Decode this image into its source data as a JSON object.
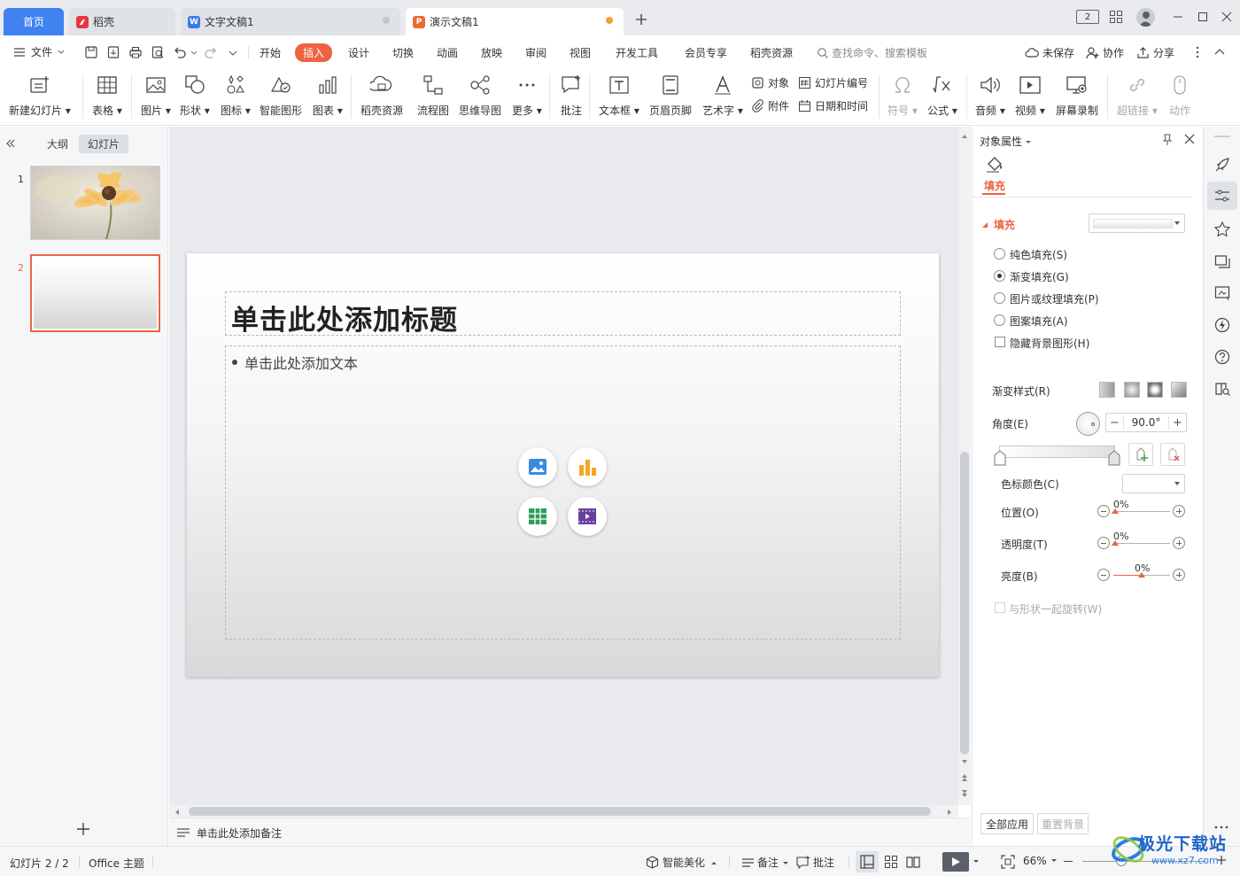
{
  "tabs": {
    "home": "首页",
    "daoke": "稻壳",
    "doc": "文字文稿1",
    "ppt": "演示文稿1",
    "version_badge": "2"
  },
  "menu": {
    "file": "文件",
    "items": [
      "开始",
      "插入",
      "设计",
      "切换",
      "动画",
      "放映",
      "审阅",
      "视图",
      "开发工具",
      "会员专享",
      "稻壳资源"
    ],
    "active": "插入",
    "search_placeholder": "查找命令、搜索模板",
    "unsaved": "未保存",
    "collab": "协作",
    "share": "分享"
  },
  "ribbon": {
    "new_slide": "新建幻灯片",
    "table": "表格",
    "picture": "图片",
    "shape": "形状",
    "icon": "图标",
    "smart_graphic": "智能图形",
    "chart": "图表",
    "daoke_resource": "稻壳资源",
    "flowchart": "流程图",
    "mindmap": "思维导图",
    "more": "更多",
    "comment": "批注",
    "textbox": "文本框",
    "header_footer": "页眉页脚",
    "wordart": "艺术字",
    "object": "对象",
    "attachment": "附件",
    "slide_number": "幻灯片编号",
    "datetime": "日期和时间",
    "symbol": "符号",
    "formula": "公式",
    "audio": "音频",
    "video": "视频",
    "screen_record": "屏幕录制",
    "hyperlink": "超链接",
    "action": "动作"
  },
  "left_panel": {
    "outline_tab": "大纲",
    "slides_tab": "幻灯片",
    "slide_numbers": [
      "1",
      "2"
    ]
  },
  "slide": {
    "title_placeholder": "单击此处添加标题",
    "body_placeholder": "单击此处添加文本"
  },
  "notes_placeholder": "单击此处添加备注",
  "props": {
    "title": "对象属性",
    "fill_tab": "填充",
    "fill_section": "填充",
    "solid_fill": "纯色填充(S)",
    "gradient_fill": "渐变填充(G)",
    "picture_fill": "图片或纹理填充(P)",
    "pattern_fill": "图案填充(A)",
    "hide_bg": "隐藏背景图形(H)",
    "gradient_style": "渐变样式(R)",
    "angle_label": "角度(E)",
    "angle_value": "90.0°",
    "stop_color": "色标颜色(C)",
    "position": "位置(O)",
    "position_value": "0%",
    "transparency": "透明度(T)",
    "transparency_value": "0%",
    "brightness": "亮度(B)",
    "brightness_value": "0%",
    "rotate_with_shape": "与形状一起旋转(W)",
    "apply_all": "全部应用",
    "reset_bg": "重置背景",
    "selected_fill": "gradient"
  },
  "status": {
    "slide_info": "幻灯片 2 / 2",
    "theme": "Office 主题",
    "smart_beautify": "智能美化",
    "notes": "备注",
    "comment": "批注",
    "zoom": "66%"
  },
  "watermark": {
    "brand": "极光下载站",
    "url": "www.xz7.com"
  },
  "colors": {
    "accent": "#ee6342",
    "home_tab": "#3f82f0"
  }
}
